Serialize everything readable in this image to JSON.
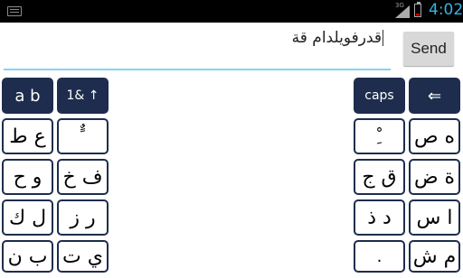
{
  "status_bar": {
    "network_type": "3G",
    "time": "4:02",
    "battery_level": 0.15,
    "battery_color": "#cc0000",
    "clock_color": "#33b5e5"
  },
  "input": {
    "text": "قدرفويلدام قة"
  },
  "send_label": "Send",
  "keyboard": {
    "key_color": "#1e2d4d",
    "left": {
      "row0": {
        "letters_label": "a b",
        "symbols_label": "1& ↑"
      },
      "row1": [
        "ع ط",
        "ٌ ً"
      ],
      "row2": [
        "و ح",
        "ف خ"
      ],
      "row3": [
        "ل ك",
        "ر ز"
      ],
      "row4": [
        "ب ن",
        "ي ت"
      ]
    },
    "right": {
      "row0": {
        "caps_label": "caps",
        "backspace_label": "⇐"
      },
      "row1": [
        "ِ ْ",
        "ه ص"
      ],
      "row2": [
        "ق ج",
        "ة ض"
      ],
      "row3": [
        "د ذ",
        "ا س"
      ],
      "row4": [
        ".",
        "م ش"
      ]
    }
  }
}
